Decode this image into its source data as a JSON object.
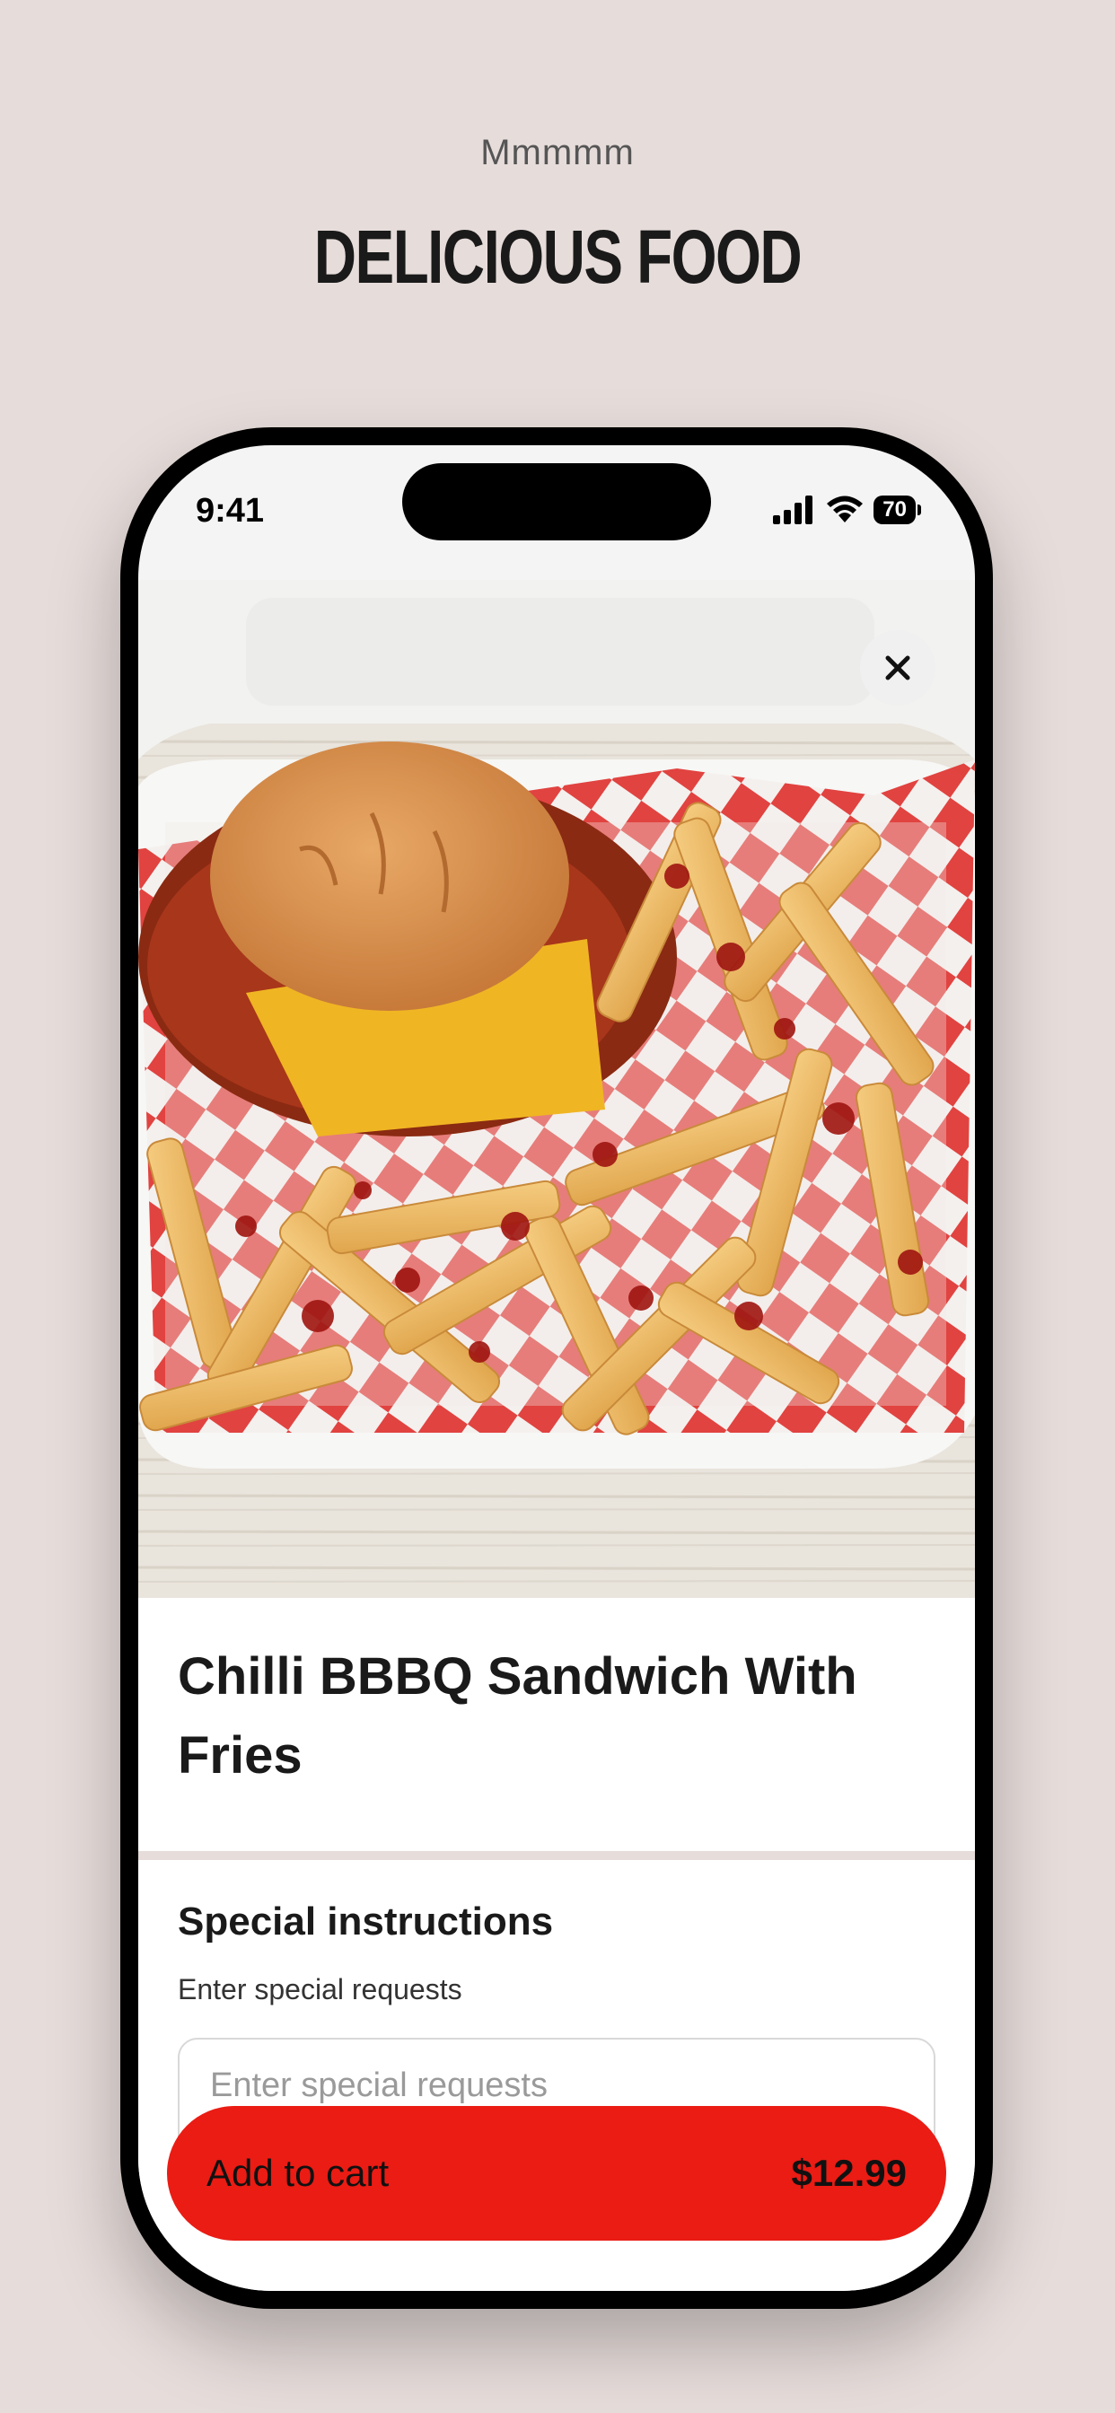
{
  "header": {
    "eyebrow": "Mmmmm",
    "headline": "DELICIOUS FOOD"
  },
  "status_bar": {
    "time": "9:41",
    "battery": "70"
  },
  "item": {
    "title": "Chilli BBBQ Sandwich With Fries",
    "image_icon": "food-photo"
  },
  "special_instructions": {
    "title": "Special instructions",
    "subtitle": "Enter special requests",
    "placeholder": "Enter special requests"
  },
  "cart": {
    "label": "Add to cart",
    "price": "$12.99"
  },
  "colors": {
    "background": "#e6dcda",
    "accent": "#ea1c14"
  }
}
